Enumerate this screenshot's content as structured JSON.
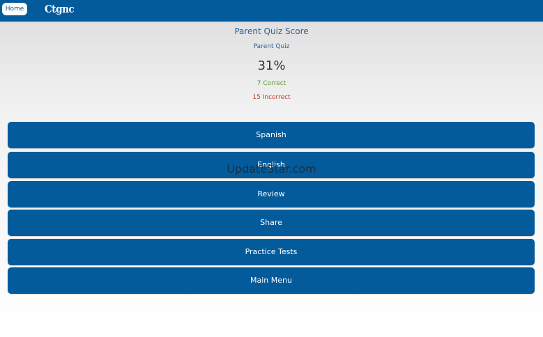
{
  "header": {
    "home_label": "Home",
    "logo_text": "Ctgnc"
  },
  "score": {
    "title": "Parent Quiz Score",
    "quiz_name": "Parent Quiz",
    "percent": "31%",
    "correct": "7 Correct",
    "incorrect": "15 Incorrect"
  },
  "menu": {
    "buttons": [
      {
        "label": "Spanish"
      },
      {
        "label": "English"
      },
      {
        "label": "Review"
      },
      {
        "label": "Share"
      },
      {
        "label": "Practice Tests"
      },
      {
        "label": "Main Menu"
      }
    ]
  },
  "watermark": "UpdateStar.com",
  "colors": {
    "brand_blue": "#045b9c",
    "correct_green": "#5a9a2a",
    "incorrect_red": "#c0392b"
  }
}
